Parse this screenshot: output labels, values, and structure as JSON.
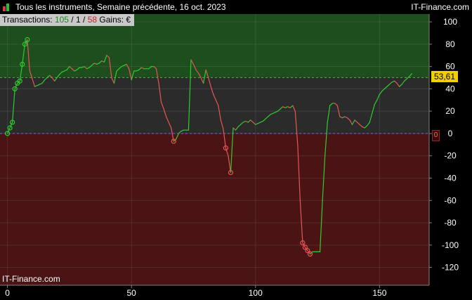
{
  "header": {
    "title": "Tous les instruments, Semaine précédente, 16 oct. 2023",
    "brand": "IT-Finance.com"
  },
  "stats": {
    "transactions_label": "Transactions:",
    "wins": "105",
    "separator1": " / ",
    "neutral": "1",
    "separator2": " / ",
    "losses": "58",
    "gains_label": "Gains: €"
  },
  "watermark": "IT-Finance.com",
  "last_value_label": "53,61",
  "zero_marker_label": "0",
  "colors": {
    "up": "#2ecc2e",
    "down": "#e85555",
    "profit_zone": "#1e4d1e",
    "neutral_zone": "#2b2b2b",
    "loss_zone": "#4a1414",
    "last_value_bg": "#f2d000"
  },
  "chart_data": {
    "type": "line",
    "title": "",
    "xlabel": "",
    "ylabel": "",
    "xlim": [
      -3,
      170
    ],
    "ylim": [
      -136,
      107
    ],
    "x_ticks": [
      0,
      50,
      100,
      150
    ],
    "y_ticks": [
      100,
      80,
      60,
      40,
      20,
      0,
      -20,
      -40,
      -60,
      -80,
      -100,
      -120
    ],
    "reference_levels": {
      "target": 50,
      "zero": 0
    },
    "last_value": 53.61,
    "series": [
      {
        "values": [
          [
            0,
            0
          ],
          [
            1,
            5
          ],
          [
            2,
            10
          ],
          [
            3,
            40
          ],
          [
            4,
            45
          ],
          [
            5,
            47
          ],
          [
            6,
            62
          ],
          [
            7,
            80
          ],
          [
            8,
            84
          ],
          [
            9,
            56
          ],
          [
            10,
            49
          ],
          [
            11,
            42
          ],
          [
            12,
            43
          ],
          [
            13,
            44
          ],
          [
            14,
            45
          ],
          [
            15,
            48
          ],
          [
            16,
            50
          ],
          [
            17,
            52
          ],
          [
            18,
            50
          ],
          [
            19,
            47
          ],
          [
            20,
            50
          ],
          [
            21,
            53
          ],
          [
            22,
            55
          ],
          [
            23,
            56
          ],
          [
            24,
            57
          ],
          [
            25,
            60
          ],
          [
            26,
            58
          ],
          [
            27,
            56
          ],
          [
            28,
            57
          ],
          [
            29,
            59
          ],
          [
            30,
            59
          ],
          [
            31,
            60
          ],
          [
            32,
            58
          ],
          [
            33,
            59
          ],
          [
            34,
            61
          ],
          [
            35,
            63
          ],
          [
            36,
            62
          ],
          [
            37,
            63
          ],
          [
            38,
            65
          ],
          [
            39,
            64
          ],
          [
            40,
            70
          ],
          [
            41,
            68
          ],
          [
            42,
            50
          ],
          [
            43,
            45
          ],
          [
            44,
            56
          ],
          [
            45,
            58
          ],
          [
            46,
            60
          ],
          [
            47,
            61
          ],
          [
            48,
            62
          ],
          [
            49,
            58
          ],
          [
            50,
            48
          ],
          [
            51,
            56
          ],
          [
            52,
            56
          ],
          [
            53,
            57
          ],
          [
            54,
            59
          ],
          [
            55,
            58
          ],
          [
            56,
            58
          ],
          [
            57,
            58
          ],
          [
            58,
            60
          ],
          [
            59,
            60
          ],
          [
            60,
            58
          ],
          [
            61,
            45
          ],
          [
            62,
            28
          ],
          [
            63,
            22
          ],
          [
            64,
            15
          ],
          [
            65,
            10
          ],
          [
            66,
            5
          ],
          [
            67,
            -7
          ],
          [
            68,
            -5
          ],
          [
            69,
            0
          ],
          [
            70,
            2
          ],
          [
            71,
            3
          ],
          [
            72,
            3
          ],
          [
            73,
            3
          ],
          [
            74,
            66
          ],
          [
            75,
            62
          ],
          [
            76,
            57
          ],
          [
            77,
            54
          ],
          [
            78,
            50
          ],
          [
            79,
            45
          ],
          [
            80,
            57
          ],
          [
            81,
            50
          ],
          [
            82,
            42
          ],
          [
            83,
            35
          ],
          [
            84,
            30
          ],
          [
            85,
            25
          ],
          [
            86,
            12
          ],
          [
            87,
            4
          ],
          [
            88,
            -13
          ],
          [
            89,
            -20
          ],
          [
            90,
            -35
          ],
          [
            91,
            5
          ],
          [
            92,
            3
          ],
          [
            93,
            6
          ],
          [
            94,
            8
          ],
          [
            95,
            10
          ],
          [
            96,
            11
          ],
          [
            97,
            10
          ],
          [
            98,
            12
          ],
          [
            99,
            10
          ],
          [
            100,
            8
          ],
          [
            101,
            9
          ],
          [
            102,
            10
          ],
          [
            103,
            11
          ],
          [
            104,
            13
          ],
          [
            105,
            15
          ],
          [
            106,
            17
          ],
          [
            107,
            18
          ],
          [
            108,
            19
          ],
          [
            109,
            20
          ],
          [
            110,
            22
          ],
          [
            111,
            24
          ],
          [
            112,
            23
          ],
          [
            113,
            24
          ],
          [
            114,
            23
          ],
          [
            115,
            25
          ],
          [
            116,
            20
          ],
          [
            117,
            -10
          ],
          [
            118,
            -60
          ],
          [
            119,
            -98
          ],
          [
            120,
            -102
          ],
          [
            121,
            -105
          ],
          [
            122,
            -108
          ],
          [
            123,
            -106
          ],
          [
            124,
            -106
          ],
          [
            125,
            -106
          ],
          [
            126,
            -106
          ],
          [
            127,
            -60
          ],
          [
            128,
            -20
          ],
          [
            129,
            10
          ],
          [
            130,
            25
          ],
          [
            131,
            27
          ],
          [
            132,
            27
          ],
          [
            133,
            25
          ],
          [
            134,
            15
          ],
          [
            135,
            14
          ],
          [
            136,
            15
          ],
          [
            137,
            14
          ],
          [
            138,
            12
          ],
          [
            139,
            8
          ],
          [
            140,
            12
          ],
          [
            141,
            10
          ],
          [
            142,
            8
          ],
          [
            143,
            6
          ],
          [
            144,
            5
          ],
          [
            145,
            7
          ],
          [
            146,
            10
          ],
          [
            147,
            18
          ],
          [
            148,
            26
          ],
          [
            149,
            30
          ],
          [
            150,
            35
          ],
          [
            151,
            38
          ],
          [
            152,
            40
          ],
          [
            153,
            42
          ],
          [
            154,
            44
          ],
          [
            155,
            46
          ],
          [
            156,
            47
          ],
          [
            157,
            45
          ],
          [
            158,
            42
          ],
          [
            159,
            44
          ],
          [
            160,
            47
          ],
          [
            161,
            49
          ],
          [
            162,
            51
          ],
          [
            163,
            53.61
          ]
        ]
      }
    ],
    "markers": [
      [
        0,
        0
      ],
      [
        1,
        5
      ],
      [
        2,
        10
      ],
      [
        3,
        40
      ],
      [
        4,
        45
      ],
      [
        5,
        47
      ],
      [
        6,
        62
      ],
      [
        7,
        80
      ],
      [
        8,
        84
      ],
      [
        67,
        -7
      ],
      [
        88,
        -13
      ],
      [
        90,
        -35
      ],
      [
        119,
        -98
      ],
      [
        120,
        -102
      ],
      [
        121,
        -105
      ],
      [
        122,
        -108
      ]
    ]
  }
}
